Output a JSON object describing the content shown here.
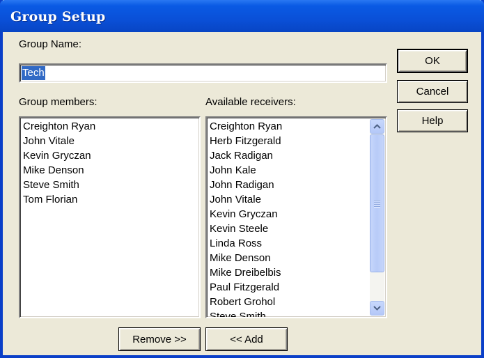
{
  "window": {
    "title": "Group Setup"
  },
  "group_name": {
    "label": "Group Name:",
    "value": "Tech"
  },
  "buttons": {
    "ok": "OK",
    "cancel": "Cancel",
    "help": "Help",
    "remove": "Remove >>",
    "add": "<< Add"
  },
  "group_members": {
    "label": "Group members:",
    "items": [
      "Creighton Ryan",
      "John Vitale",
      "Kevin Gryczan",
      "Mike Denson",
      "Steve Smith",
      "Tom Florian"
    ]
  },
  "available_receivers": {
    "label": "Available receivers:",
    "items": [
      "Creighton Ryan",
      "Herb Fitzgerald",
      "Jack Radigan",
      "John Kale",
      "John Radigan",
      "John Vitale",
      "Kevin Gryczan",
      "Kevin Steele",
      "Linda Ross",
      "Mike Denson",
      "Mike Dreibelbis",
      "Paul Fitzgerald",
      "Robert Grohol",
      "Steve Smith"
    ]
  },
  "icons": {
    "scroll_up": "scroll-up-arrow-icon",
    "scroll_down": "scroll-down-arrow-icon",
    "thumb_grip": "scroll-grip-icon"
  },
  "colors": {
    "title_bar": "#0a50d8",
    "selection": "#316ac5",
    "dialog_bg": "#ece9d8"
  }
}
